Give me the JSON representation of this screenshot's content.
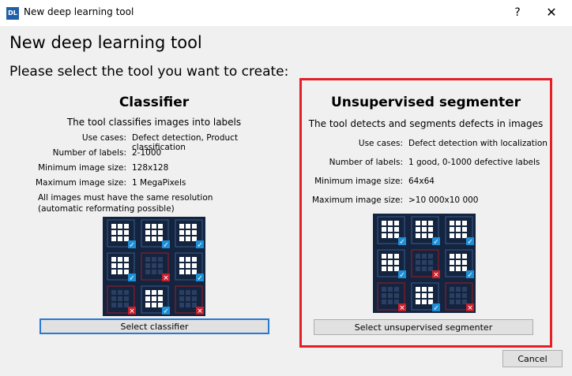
{
  "window": {
    "title": "New deep learning tool",
    "icon_text": "DL",
    "help_label": "?",
    "close_label": "✕"
  },
  "heading": "New deep learning tool",
  "subheading": "Please select the tool you want to create:",
  "classifier": {
    "title": "Classifier",
    "description": "The tool classifies images into labels",
    "rows": [
      {
        "key": "Use cases:",
        "value": "Defect detection, Product classification"
      },
      {
        "key": "Number of labels:",
        "value": "2-1000"
      },
      {
        "key": "Minimum image size:",
        "value": "128x128"
      },
      {
        "key": "Maximum image size:",
        "value": "1 MegaPixels"
      }
    ],
    "note": "All images must have the same resolution (automatic reformating possible)",
    "button_label": "Select classifier",
    "tiles": [
      "ok",
      "ok",
      "ok",
      "ok",
      "defect",
      "ok",
      "defect",
      "ok",
      "defect"
    ]
  },
  "segmenter": {
    "title": "Unsupervised segmenter",
    "description": "The tool detects and segments defects in images",
    "rows": [
      {
        "key": "Use cases:",
        "value": "Defect detection with localization"
      },
      {
        "key": "Number of labels:",
        "value": "1 good, 0-1000 defective labels"
      },
      {
        "key": "Minimum image size:",
        "value": "64x64"
      },
      {
        "key": "Maximum image size:",
        "value": ">10 000x10 000"
      }
    ],
    "button_label": "Select unsupervised segmenter",
    "tiles": [
      "ok",
      "ok",
      "ok",
      "ok",
      "defect",
      "ok",
      "defect",
      "ok",
      "defect"
    ]
  },
  "cancel_label": "Cancel",
  "colors": {
    "selection_border": "#e41f26",
    "focus_border": "#2679d4",
    "tile_bg": "#14243f",
    "ok_mark": "#1e8fd6",
    "defect_mark": "#c8202a"
  }
}
